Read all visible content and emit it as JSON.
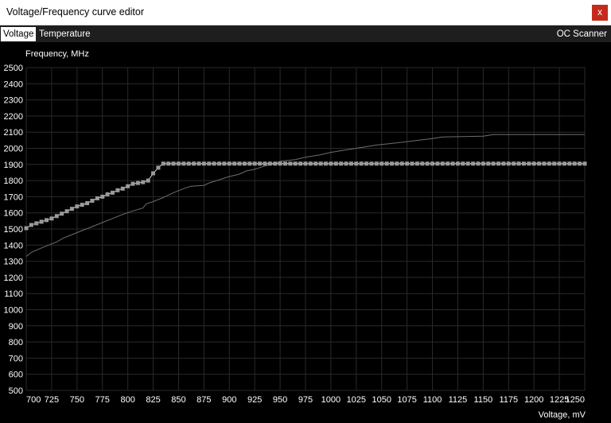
{
  "window": {
    "title": "Voltage/Frequency curve editor",
    "close_label": "x"
  },
  "tabs": {
    "voltage": "Voltage",
    "temperature": "Temperature",
    "oc_scanner": "OC Scanner"
  },
  "colors": {
    "background": "#000000",
    "grid": "#2a2a2a",
    "curve_points": "#9a9a9a",
    "reference_curve": "#6e6e6e",
    "text": "#ffffff",
    "close_button": "#c42b1c"
  },
  "chart_data": {
    "type": "line",
    "xlabel": "Voltage, mV",
    "ylabel": "Frequency, MHz",
    "xlim": [
      700,
      1250
    ],
    "ylim": [
      500,
      2500
    ],
    "x_ticks": [
      700,
      725,
      750,
      775,
      800,
      825,
      850,
      875,
      900,
      925,
      950,
      975,
      1000,
      1025,
      1050,
      1075,
      1100,
      1125,
      1150,
      1175,
      1200,
      1225,
      1250
    ],
    "y_ticks": [
      500,
      600,
      700,
      800,
      900,
      1000,
      1100,
      1200,
      1300,
      1400,
      1500,
      1600,
      1700,
      1800,
      1900,
      2000,
      2100,
      2200,
      2300,
      2400,
      2500
    ],
    "grid": true,
    "series": [
      {
        "role": "reference",
        "points": [
          [
            700,
            1330
          ],
          [
            705,
            1355
          ],
          [
            712,
            1375
          ],
          [
            720,
            1395
          ],
          [
            730,
            1420
          ],
          [
            737,
            1445
          ],
          [
            745,
            1465
          ],
          [
            755,
            1490
          ],
          [
            765,
            1515
          ],
          [
            775,
            1540
          ],
          [
            785,
            1565
          ],
          [
            795,
            1590
          ],
          [
            805,
            1612
          ],
          [
            815,
            1630
          ],
          [
            818,
            1655
          ],
          [
            825,
            1670
          ],
          [
            835,
            1695
          ],
          [
            845,
            1725
          ],
          [
            855,
            1750
          ],
          [
            862,
            1765
          ],
          [
            875,
            1770
          ],
          [
            880,
            1785
          ],
          [
            890,
            1805
          ],
          [
            900,
            1825
          ],
          [
            910,
            1840
          ],
          [
            917,
            1860
          ],
          [
            925,
            1870
          ],
          [
            935,
            1890
          ],
          [
            945,
            1905
          ],
          [
            950,
            1920
          ],
          [
            965,
            1930
          ],
          [
            975,
            1945
          ],
          [
            990,
            1960
          ],
          [
            1000,
            1975
          ],
          [
            1015,
            1990
          ],
          [
            1030,
            2005
          ],
          [
            1045,
            2020
          ],
          [
            1060,
            2030
          ],
          [
            1080,
            2045
          ],
          [
            1100,
            2060
          ],
          [
            1110,
            2070
          ],
          [
            1150,
            2075
          ],
          [
            1160,
            2085
          ],
          [
            1250,
            2085
          ]
        ]
      },
      {
        "role": "curve",
        "points": [
          [
            700,
            1505
          ],
          [
            705,
            1525
          ],
          [
            710,
            1535
          ],
          [
            715,
            1545
          ],
          [
            720,
            1555
          ],
          [
            725,
            1565
          ],
          [
            730,
            1580
          ],
          [
            735,
            1595
          ],
          [
            740,
            1610
          ],
          [
            745,
            1625
          ],
          [
            750,
            1640
          ],
          [
            755,
            1650
          ],
          [
            760,
            1660
          ],
          [
            765,
            1675
          ],
          [
            770,
            1690
          ],
          [
            775,
            1700
          ],
          [
            780,
            1715
          ],
          [
            785,
            1725
          ],
          [
            790,
            1740
          ],
          [
            795,
            1750
          ],
          [
            800,
            1765
          ],
          [
            805,
            1780
          ],
          [
            810,
            1785
          ],
          [
            815,
            1790
          ],
          [
            820,
            1800
          ],
          [
            825,
            1845
          ],
          [
            830,
            1880
          ],
          [
            835,
            1905
          ],
          [
            840,
            1905
          ],
          [
            845,
            1905
          ],
          [
            850,
            1905
          ],
          [
            855,
            1905
          ],
          [
            860,
            1905
          ],
          [
            865,
            1905
          ],
          [
            870,
            1905
          ],
          [
            875,
            1905
          ],
          [
            880,
            1905
          ],
          [
            885,
            1905
          ],
          [
            890,
            1905
          ],
          [
            895,
            1905
          ],
          [
            900,
            1905
          ],
          [
            905,
            1905
          ],
          [
            910,
            1905
          ],
          [
            915,
            1905
          ],
          [
            920,
            1905
          ],
          [
            925,
            1905
          ],
          [
            930,
            1905
          ],
          [
            935,
            1905
          ],
          [
            940,
            1905
          ],
          [
            945,
            1905
          ],
          [
            950,
            1905
          ],
          [
            955,
            1905
          ],
          [
            960,
            1905
          ],
          [
            965,
            1905
          ],
          [
            970,
            1905
          ],
          [
            975,
            1905
          ],
          [
            980,
            1905
          ],
          [
            985,
            1905
          ],
          [
            990,
            1905
          ],
          [
            995,
            1905
          ],
          [
            1000,
            1905
          ],
          [
            1005,
            1905
          ],
          [
            1010,
            1905
          ],
          [
            1015,
            1905
          ],
          [
            1020,
            1905
          ],
          [
            1025,
            1905
          ],
          [
            1030,
            1905
          ],
          [
            1035,
            1905
          ],
          [
            1040,
            1905
          ],
          [
            1045,
            1905
          ],
          [
            1050,
            1905
          ],
          [
            1055,
            1905
          ],
          [
            1060,
            1905
          ],
          [
            1065,
            1905
          ],
          [
            1070,
            1905
          ],
          [
            1075,
            1905
          ],
          [
            1080,
            1905
          ],
          [
            1085,
            1905
          ],
          [
            1090,
            1905
          ],
          [
            1095,
            1905
          ],
          [
            1100,
            1905
          ],
          [
            1105,
            1905
          ],
          [
            1110,
            1905
          ],
          [
            1115,
            1905
          ],
          [
            1120,
            1905
          ],
          [
            1125,
            1905
          ],
          [
            1130,
            1905
          ],
          [
            1135,
            1905
          ],
          [
            1140,
            1905
          ],
          [
            1145,
            1905
          ],
          [
            1150,
            1905
          ],
          [
            1155,
            1905
          ],
          [
            1160,
            1905
          ],
          [
            1165,
            1905
          ],
          [
            1170,
            1905
          ],
          [
            1175,
            1905
          ],
          [
            1180,
            1905
          ],
          [
            1185,
            1905
          ],
          [
            1190,
            1905
          ],
          [
            1195,
            1905
          ],
          [
            1200,
            1905
          ],
          [
            1205,
            1905
          ],
          [
            1210,
            1905
          ],
          [
            1215,
            1905
          ],
          [
            1220,
            1905
          ],
          [
            1225,
            1905
          ],
          [
            1230,
            1905
          ],
          [
            1235,
            1905
          ],
          [
            1240,
            1905
          ],
          [
            1245,
            1905
          ],
          [
            1250,
            1905
          ]
        ]
      }
    ]
  }
}
